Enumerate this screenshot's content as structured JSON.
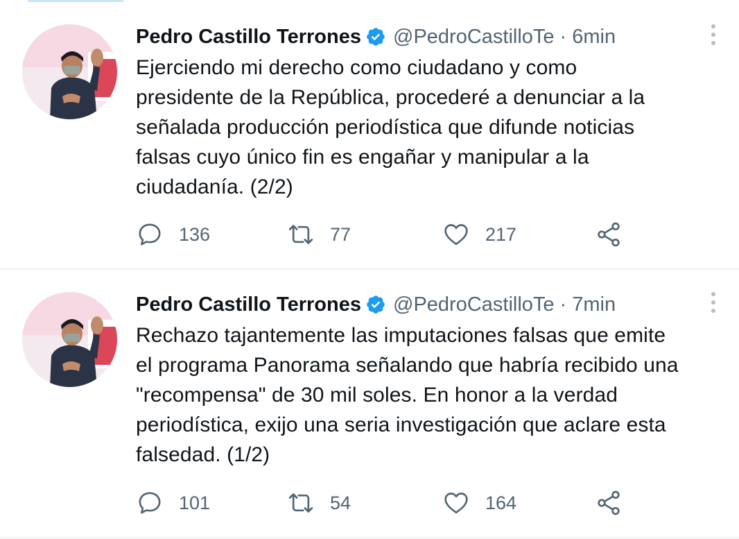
{
  "tweets": [
    {
      "author_name": "Pedro Castillo Terrones",
      "handle": "@PedroCastilloTe",
      "separator": "·",
      "time": "6min",
      "text_lines": [
        "Ejerciendo mi derecho como ciudadano y como",
        "presidente de la República, procederé a denunciar a la",
        "señalada producción periodística que difunde noticias",
        "falsas cuyo único fin es engañar y manipular a la",
        "ciudadanía. (2/2)"
      ],
      "replies": "136",
      "retweets": "77",
      "likes": "217"
    },
    {
      "author_name": "Pedro Castillo Terrones",
      "handle": "@PedroCastilloTe",
      "separator": "·",
      "time": "7min",
      "text_lines": [
        "Rechazo tajantemente las imputaciones falsas que emite",
        "el programa Panorama señalando que habría recibido una",
        "\"recompensa\" de 30 mil soles. En honor a la verdad",
        "periodística, exijo una seria investigación que aclare esta",
        "falsedad. (1/2)"
      ],
      "replies": "101",
      "retweets": "54",
      "likes": "164"
    }
  ],
  "colors": {
    "text_primary": "#0f1419",
    "text_secondary": "#536471",
    "verified_blue": "#1d9bf0",
    "divider": "#eff3f4"
  },
  "icons": [
    "verified-badge-icon",
    "more-options-icon",
    "reply-icon",
    "retweet-icon",
    "like-icon",
    "share-icon"
  ]
}
